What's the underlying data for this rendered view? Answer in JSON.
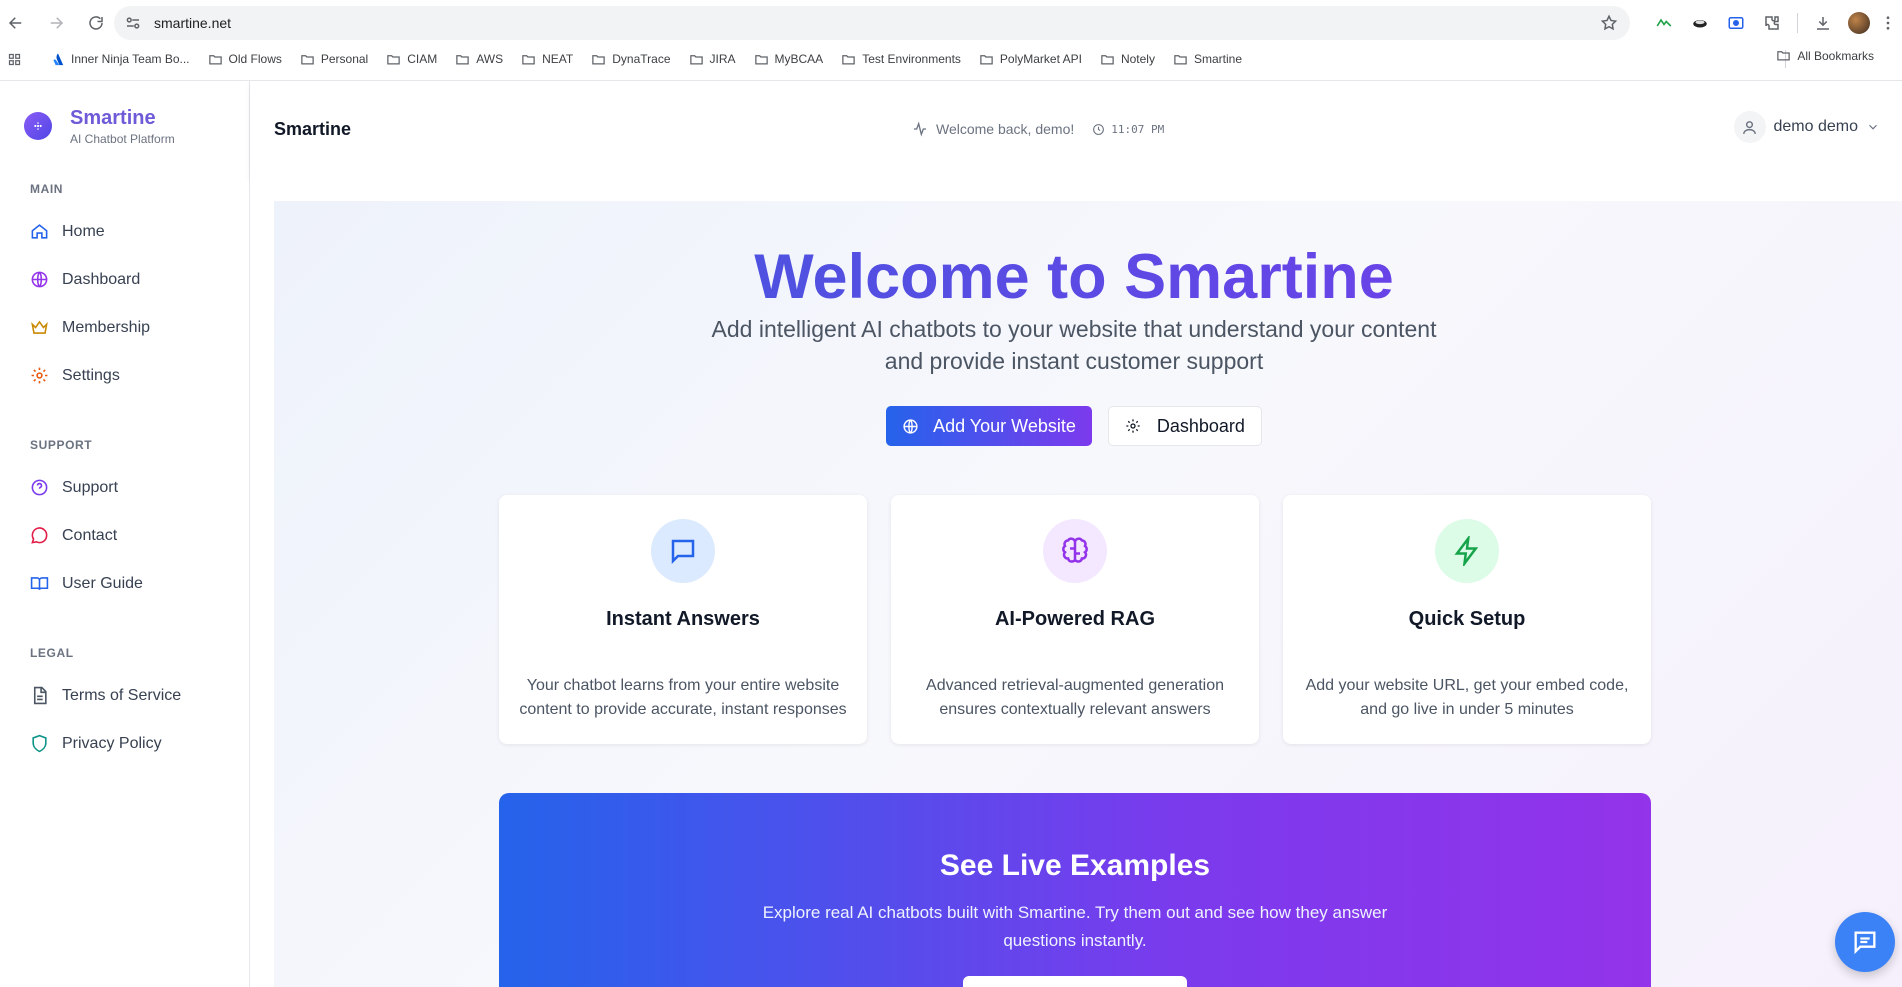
{
  "browser": {
    "url": "smartine.net",
    "bookmarks": [
      "Inner Ninja Team Bo...",
      "Old Flows",
      "Personal",
      "CIAM",
      "AWS",
      "NEAT",
      "DynaTrace",
      "JIRA",
      "MyBCAA",
      "Test Environments",
      "PolyMarket API",
      "Notely",
      "Smartine"
    ],
    "all_bookmarks": "All Bookmarks"
  },
  "sidebar": {
    "brand_name": "Smartine",
    "brand_sub": "AI Chatbot Platform",
    "main_title": "MAIN",
    "main_items": [
      {
        "label": "Home",
        "icon": "home-icon"
      },
      {
        "label": "Dashboard",
        "icon": "globe-icon"
      },
      {
        "label": "Membership",
        "icon": "crown-icon"
      },
      {
        "label": "Settings",
        "icon": "gear-icon"
      }
    ],
    "support_title": "SUPPORT",
    "support_items": [
      {
        "label": "Support",
        "icon": "help-circle-icon"
      },
      {
        "label": "Contact",
        "icon": "message-circle-icon"
      },
      {
        "label": "User Guide",
        "icon": "book-icon"
      }
    ],
    "legal_title": "LEGAL",
    "legal_items": [
      {
        "label": "Terms of Service",
        "icon": "document-icon"
      },
      {
        "label": "Privacy Policy",
        "icon": "shield-icon"
      }
    ]
  },
  "header": {
    "title": "Smartine",
    "welcome": "Welcome back, demo!",
    "time": "11:07 PM",
    "user_name": "demo demo"
  },
  "hero": {
    "title": "Welcome to Smartine",
    "subtitle_line1": "Add intelligent AI chatbots to your website that understand your content",
    "subtitle_line2": "and provide instant customer support",
    "primary_button": "Add Your Website",
    "secondary_button": "Dashboard"
  },
  "features": [
    {
      "title": "Instant Answers",
      "desc": "Your chatbot learns from your entire website content to provide accurate, instant responses",
      "icon": "chat-icon",
      "color": "#2563eb",
      "bg": "#dbeafe"
    },
    {
      "title": "AI-Powered RAG",
      "desc": "Advanced retrieval-augmented generation ensures contextually relevant answers",
      "icon": "brain-icon",
      "color": "#9333ea",
      "bg": "#f3e8ff"
    },
    {
      "title": "Quick Setup",
      "desc": "Add your website URL, get your embed code, and go live in under 5 minutes",
      "icon": "lightning-icon",
      "color": "#16a34a",
      "bg": "#dcfce7"
    }
  ],
  "examples": {
    "title": "See Live Examples",
    "desc": "Explore real AI chatbots built with Smartine. Try them out and see how they answer questions instantly."
  },
  "colors": {
    "brand": "#6d5bd8",
    "accent_start": "#2563eb",
    "accent_end": "#7c3aed",
    "fab": "#3b82f6"
  }
}
